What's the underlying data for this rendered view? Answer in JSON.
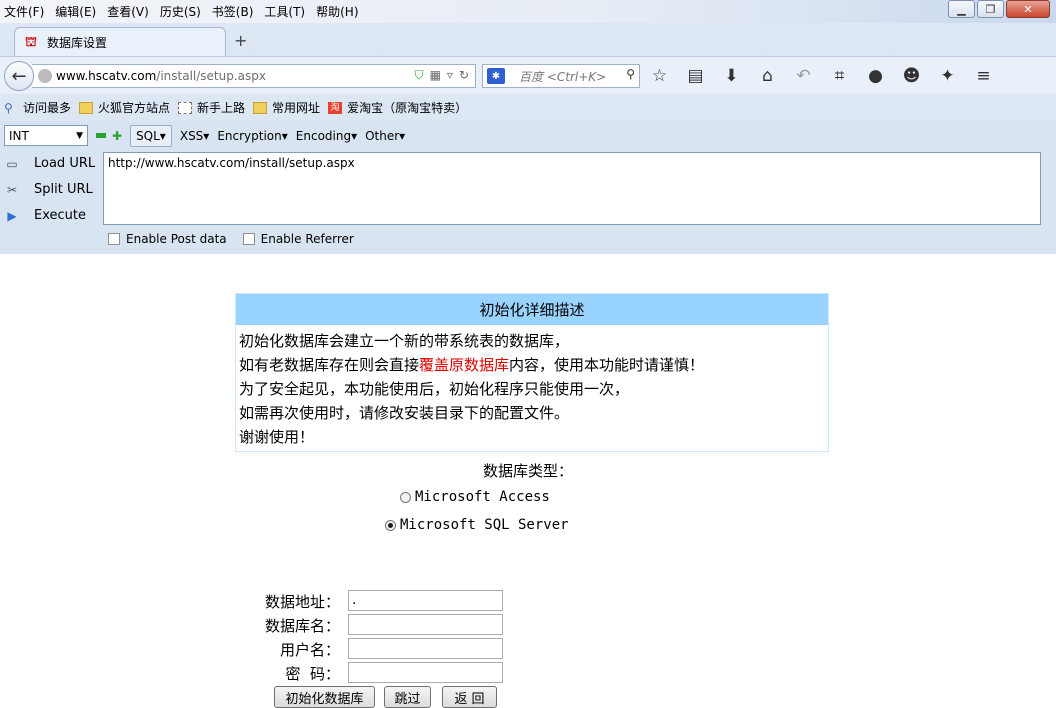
{
  "menubar": [
    "文件(F)",
    "编辑(E)",
    "查看(V)",
    "历史(S)",
    "书签(B)",
    "工具(T)",
    "帮助(H)"
  ],
  "tab": {
    "title": "数据库设置",
    "new_tab": "+"
  },
  "nav": {
    "url_host": "www.hscatv.com",
    "url_path": "/install/setup.aspx",
    "search_placeholder": "百度 <Ctrl+K>"
  },
  "bookmarks": [
    "访问最多",
    "火狐官方站点",
    "新手上路",
    "常用网址",
    "爱淘宝（原淘宝特卖）"
  ],
  "hackbar": {
    "type_select": "INT",
    "menus": [
      "SQL▾",
      "XSS▾",
      "Encryption▾",
      "Encoding▾",
      "Other▾"
    ],
    "load_url": "Load URL",
    "split_url": "Split URL",
    "execute": "Execute",
    "url_value": "http://www.hscatv.com/install/setup.aspx",
    "enable_post": "Enable Post data",
    "enable_referrer": "Enable Referrer"
  },
  "description": {
    "title": "初始化详细描述",
    "line1": "初始化数据库会建立一个新的带系统表的数据库，",
    "line2_pre": "如有老数据库存在则会直接",
    "line2_highlight": "覆盖原数据库",
    "line2_post": "内容，使用本功能时请谨慎！",
    "line3": "为了安全起见，本功能使用后，初始化程序只能使用一次，",
    "line4": "如需再次使用时，请修改安装目录下的配置文件。",
    "line5": "谢谢使用！"
  },
  "db_type": {
    "label": "数据库类型：",
    "options": [
      "Microsoft Access",
      "Microsoft SQL Server"
    ],
    "selected": "Microsoft SQL Server"
  },
  "form": {
    "address_label": "数据地址：",
    "address_value": ".",
    "dbname_label": "数据库名：",
    "dbname_value": "",
    "user_label": "用户名：",
    "user_value": "",
    "password_label": "密  码：",
    "password_value": ""
  },
  "buttons": {
    "init": "初始化数据库",
    "skip": "跳过",
    "back": "返 回"
  },
  "colors": {
    "title_bar": "#99d3ff",
    "warning": "#e00000"
  }
}
